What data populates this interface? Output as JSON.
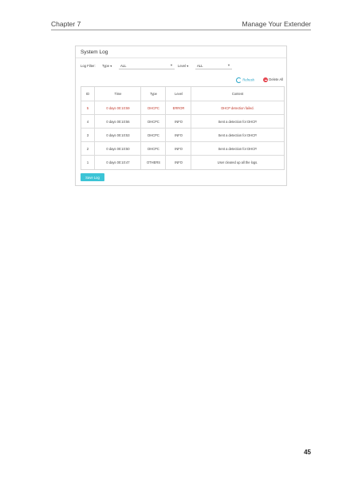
{
  "page_header": {
    "chapter": "Chapter 7",
    "title": "Manage Your Extender"
  },
  "panel": {
    "title": "System Log",
    "filter": {
      "label": "Log Filter:",
      "type_label": "Type",
      "type_value": "ALL",
      "level_label": "Level",
      "level_value": "ALL"
    },
    "actions": {
      "refresh": "Refresh",
      "delete_all": "Delete All"
    },
    "table": {
      "headers": {
        "id": "ID",
        "time": "Time",
        "type": "Type",
        "level": "Level",
        "content": "Content"
      },
      "rows": [
        {
          "id": "5",
          "time": "0 days 00:10:59",
          "type": "DHCPC",
          "level": "ERROR",
          "content": "DHCP detection failed."
        },
        {
          "id": "4",
          "time": "0 days 00:10:56",
          "type": "DHCPC",
          "level": "INFO",
          "content": "Sent a detection for DHCP."
        },
        {
          "id": "3",
          "time": "0 days 00:10:53",
          "type": "DHCPC",
          "level": "INFO",
          "content": "Sent a detection for DHCP."
        },
        {
          "id": "2",
          "time": "0 days 00:10:50",
          "type": "DHCPC",
          "level": "INFO",
          "content": "Sent a detection for DHCP."
        },
        {
          "id": "1",
          "time": "0 days 00:10:47",
          "type": "OTHERS",
          "level": "INFO",
          "content": "User cleared up all the logs."
        }
      ]
    },
    "save_button": "Save Log"
  },
  "colors": {
    "accent": "#3cc4d6",
    "error": "#c0392b",
    "delete": "#e5454f",
    "refresh": "#2aa6c8"
  },
  "page_number": "45"
}
